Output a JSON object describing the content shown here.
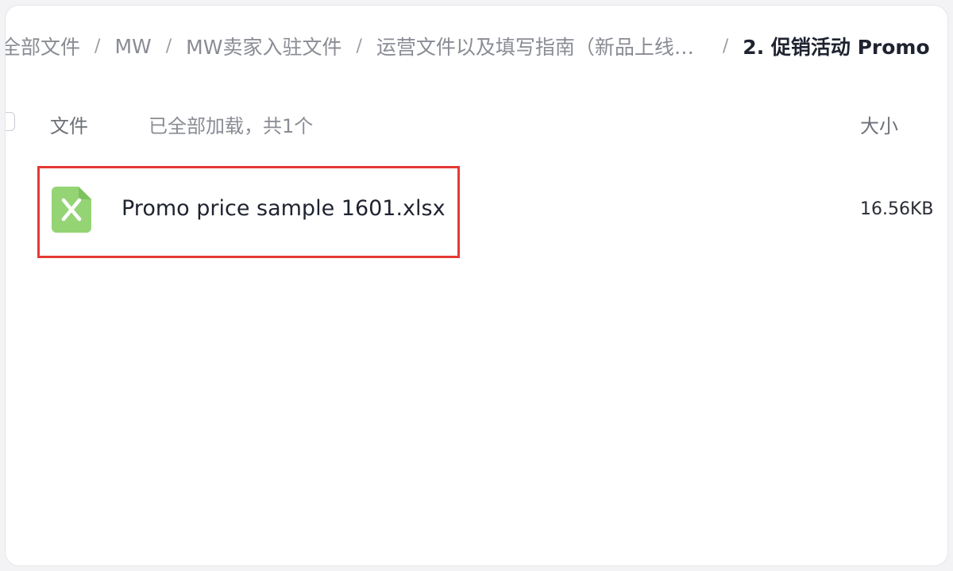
{
  "breadcrumb": {
    "items": [
      "全部文件",
      "MW",
      "MW卖家入驻文件",
      "运营文件以及填写指南（新品上线、价格、库存）",
      "2. 促销活动 Promo"
    ],
    "separator": "/"
  },
  "table": {
    "header": {
      "file_label": "文件",
      "load_status": "已全部加载，共1个",
      "size_label": "大小"
    },
    "rows": [
      {
        "name": "Promo price sample 1601.xlsx",
        "size": "16.56KB",
        "icon": "excel-file-icon",
        "highlighted": true
      }
    ]
  },
  "colors": {
    "excel_icon_bg": "#95d475",
    "highlight_border": "#e53935",
    "current_crumb": "#1f2330",
    "muted_text": "#8a8c94"
  }
}
